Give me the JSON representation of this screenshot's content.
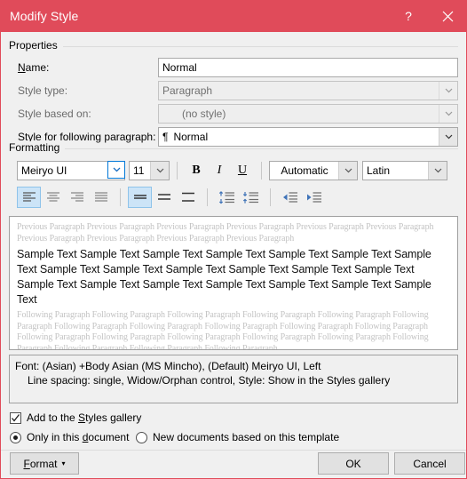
{
  "window": {
    "title": "Modify Style",
    "help_label": "?",
    "close_label": "✕",
    "accent_color": "#e04b5a"
  },
  "properties": {
    "group_label": "Properties",
    "name_label": "Name:",
    "name_value": "Normal",
    "style_type_label": "Style type:",
    "style_type_value": "Paragraph",
    "style_based_on_label": "Style based on:",
    "style_based_on_value": "(no style)",
    "style_following_label": "Style for following paragraph:",
    "style_following_value": "Normal",
    "style_following_icon": "¶"
  },
  "formatting": {
    "group_label": "Formatting",
    "font_family": "Meiryo UI",
    "font_size": "11",
    "bold_label": "B",
    "italic_label": "I",
    "underline_label": "U",
    "font_color": "Automatic",
    "script_type": "Latin",
    "align_buttons": [
      {
        "name": "align-left",
        "selected": true
      },
      {
        "name": "align-center",
        "selected": false
      },
      {
        "name": "align-right",
        "selected": false
      },
      {
        "name": "align-justify",
        "selected": false
      }
    ],
    "spacing_buttons": [
      {
        "name": "line-spacing-single",
        "selected": true
      },
      {
        "name": "line-spacing-1-5",
        "selected": false
      },
      {
        "name": "line-spacing-double",
        "selected": false
      }
    ],
    "para-space_buttons": [
      {
        "name": "add-space-before-paragraph",
        "selected": false
      },
      {
        "name": "remove-space-after-paragraph",
        "selected": false
      }
    ],
    "indent_buttons": [
      {
        "name": "decrease-indent",
        "selected": false
      },
      {
        "name": "increase-indent",
        "selected": false
      }
    ]
  },
  "preview": {
    "previous_paragraph": "Previous Paragraph Previous Paragraph Previous Paragraph Previous Paragraph Previous Paragraph Previous Paragraph Previous Paragraph Previous Paragraph Previous Paragraph Previous Paragraph",
    "sample_text": "Sample Text Sample Text Sample Text Sample Text Sample Text Sample Text Sample Text Sample Text Sample Text Sample Text Sample Text Sample Text Sample Text Sample Text Sample Text Sample Text Sample Text Sample Text Sample Text Sample Text",
    "following_paragraph": "Following Paragraph Following Paragraph Following Paragraph Following Paragraph Following Paragraph Following Paragraph Following Paragraph Following Paragraph Following Paragraph Following Paragraph Following Paragraph Following Paragraph Following Paragraph Following Paragraph Following Paragraph Following Paragraph Following Paragraph Following Paragraph Following Paragraph Following Paragraph"
  },
  "description": {
    "line1": "Font: (Asian) +Body Asian (MS Mincho), (Default) Meiryo UI, Left",
    "line2": "Line spacing:  single, Widow/Orphan control, Style: Show in the Styles gallery"
  },
  "options": {
    "add_to_gallery_label": "Add to the Styles gallery",
    "add_to_gallery_checked": true,
    "only_this_document_label": "Only in this document",
    "only_this_document_selected": true,
    "new_documents_label": "New documents based on this template",
    "new_documents_selected": false
  },
  "footer": {
    "format_label": "Format",
    "format_caret": "▾",
    "ok_label": "OK",
    "cancel_label": "Cancel"
  }
}
